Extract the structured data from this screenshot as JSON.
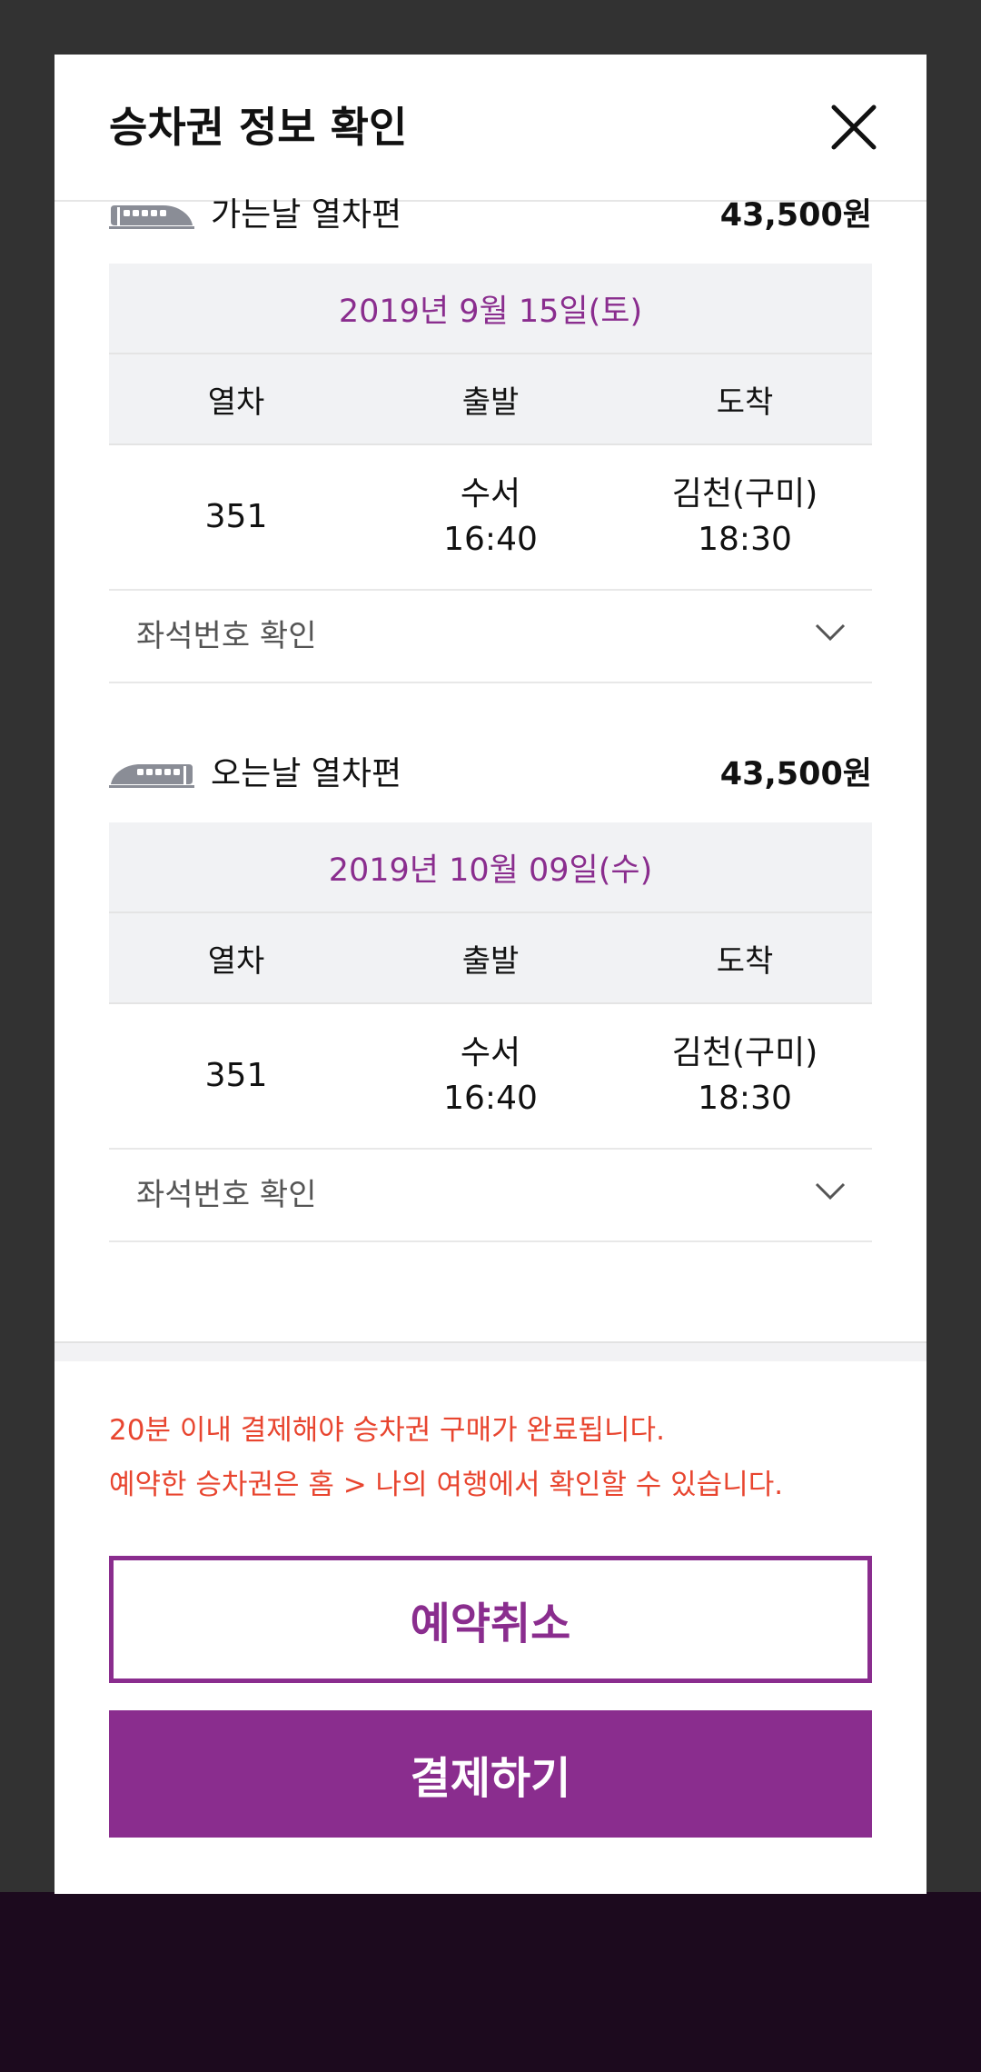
{
  "dialog": {
    "title": "승차권 정보 확인",
    "close_icon": "close-icon"
  },
  "outbound": {
    "label": "가는날 열차편",
    "price": "43,500원",
    "date": "2019년 9월 15일(토)",
    "headers": [
      "열차",
      "출발",
      "도착"
    ],
    "train_no": "351",
    "dep_station": "수서",
    "dep_time": "16:40",
    "arr_station": "김천(구미)",
    "arr_time": "18:30",
    "seat_label": "좌석번호 확인"
  },
  "inbound": {
    "label": "오는날 열차편",
    "price": "43,500원",
    "date": "2019년 10월 09일(수)",
    "headers": [
      "열차",
      "출발",
      "도착"
    ],
    "train_no": "351",
    "dep_station": "수서",
    "dep_time": "16:40",
    "arr_station": "김천(구미)",
    "arr_time": "18:30",
    "seat_label": "좌석번호 확인"
  },
  "notice": {
    "line1": "20분 이내 결제해야 승차권 구매가 완료됩니다.",
    "line2": "예약한 승차권은 홈 > 나의 여행에서 확인할 수 있습니다."
  },
  "buttons": {
    "cancel": "예약취소",
    "pay": "결제하기"
  },
  "colors": {
    "accent": "#8a2d8e",
    "notice": "#e8452f",
    "table_bg": "#f1f2f4"
  }
}
